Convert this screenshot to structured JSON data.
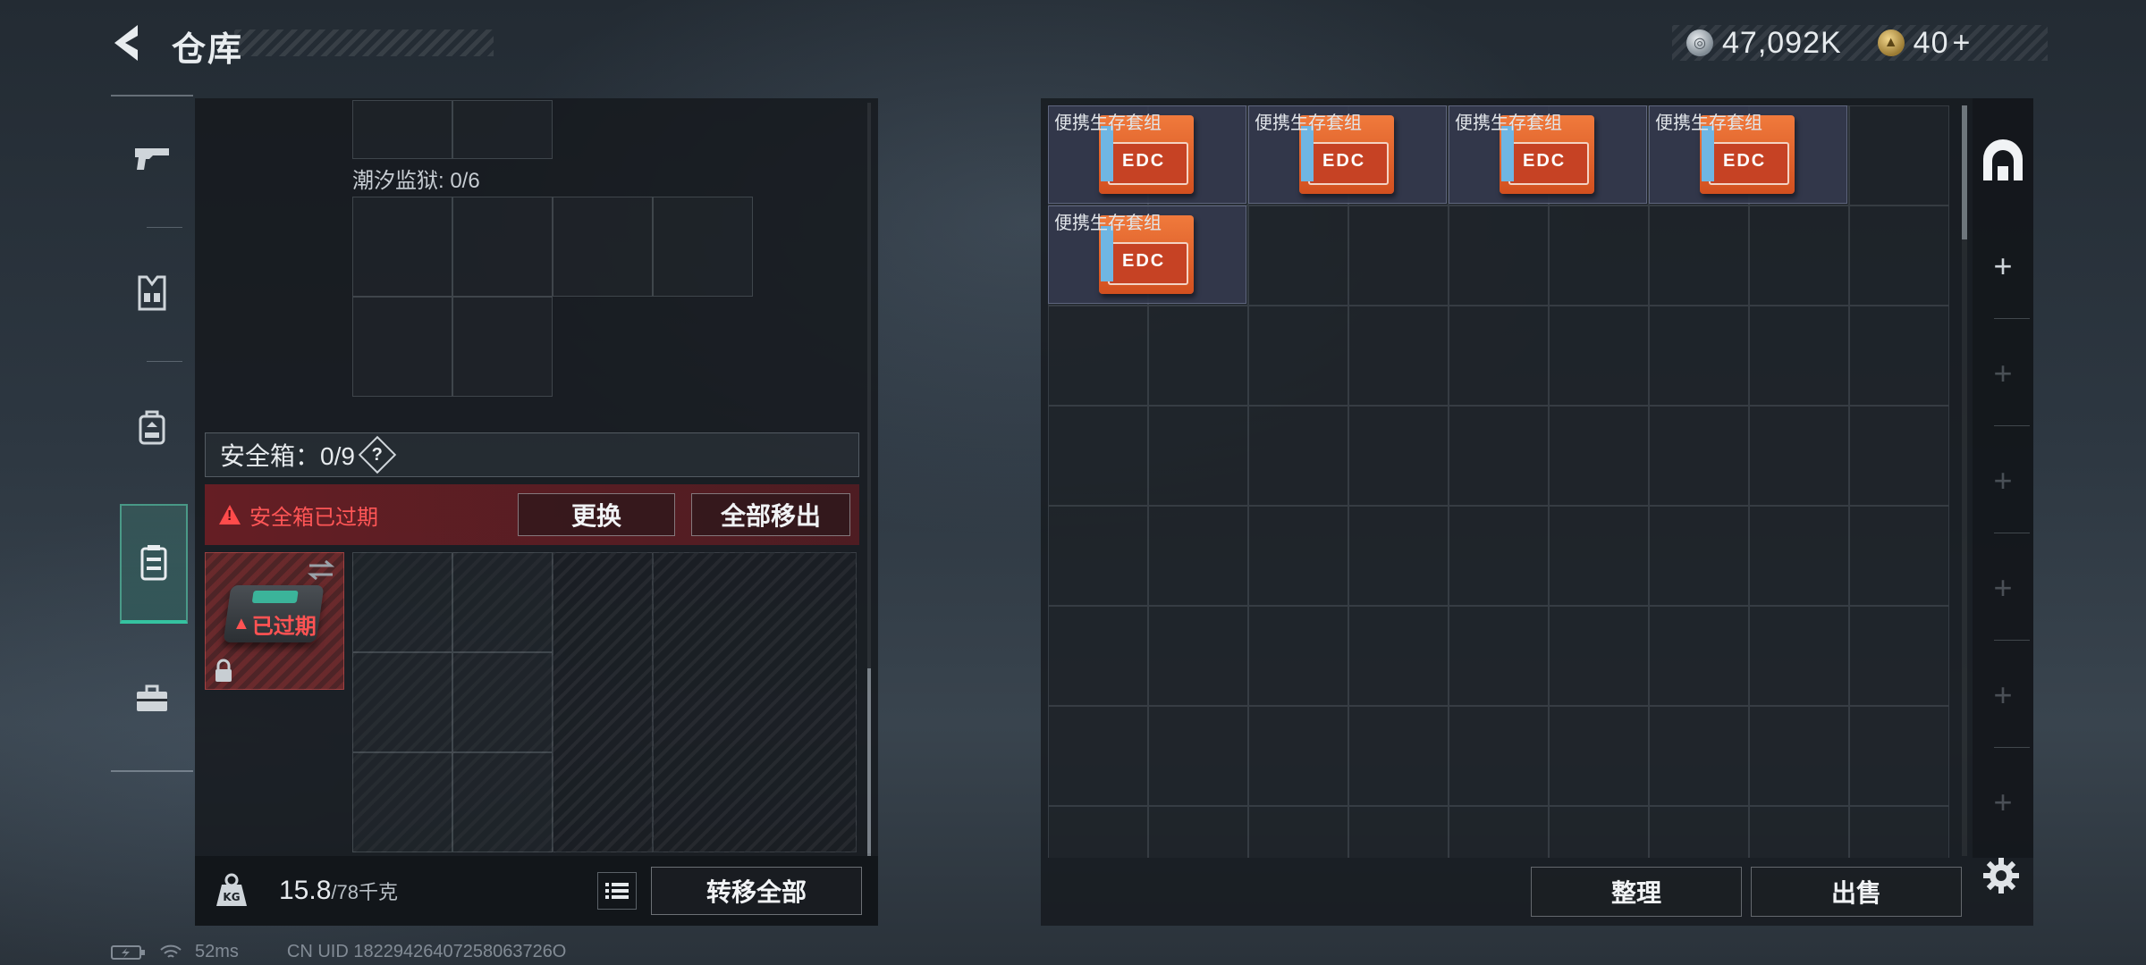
{
  "header": {
    "title": "仓库",
    "currency_silver": "47,092K",
    "currency_gold": "40",
    "currency_gold_plus": "+"
  },
  "sidebar": {
    "items": [
      {
        "icon": "gun-icon"
      },
      {
        "icon": "armor-vest-icon"
      },
      {
        "icon": "backpack-icon"
      },
      {
        "icon": "safe-case-icon",
        "active": true
      },
      {
        "icon": "toolbox-icon"
      }
    ]
  },
  "left": {
    "tide_label": "潮汐监狱: 0/6",
    "safe_box_label": "安全箱：0/9",
    "help_symbol": "?",
    "expired_warning": "安全箱已过期",
    "replace_button": "更换",
    "remove_all_button": "全部移出",
    "safe_item_expired": "已过期",
    "weight_current": "15.8",
    "weight_max": "/78千克",
    "transfer_all_button": "转移全部"
  },
  "stash": {
    "items": [
      {
        "name": "便携生存套组"
      },
      {
        "name": "便携生存套组"
      },
      {
        "name": "便携生存套组"
      },
      {
        "name": "便携生存套组"
      },
      {
        "name": "便携生存套组"
      }
    ],
    "sort_button": "整理",
    "sell_button": "出售"
  },
  "right_strip": {
    "plus": "+"
  },
  "status": {
    "ping": "52ms",
    "uid": "CN UID 18229426407258063726O"
  },
  "colors": {
    "accent_teal": "#35c2a0",
    "warning_red": "#ff5656",
    "item_orange": "#f07a3c"
  }
}
